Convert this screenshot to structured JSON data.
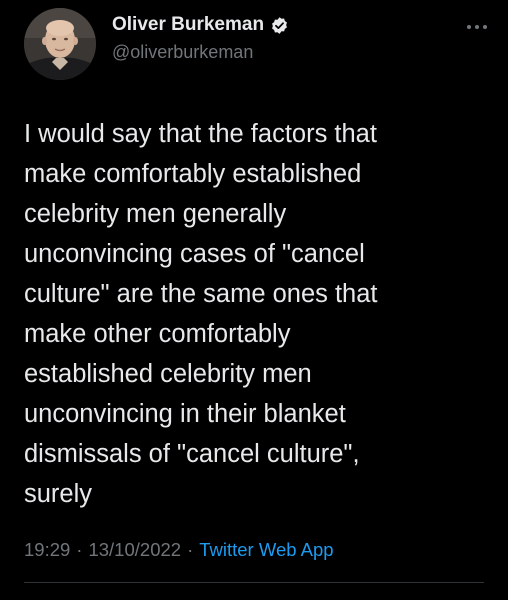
{
  "author": {
    "display_name": "Oliver Burkeman",
    "handle": "@oliverburkeman",
    "verified_icon": "verified-badge-icon",
    "verified_color": "#e7e9ea"
  },
  "tweet": {
    "text": "I would say that the factors that\nmake comfortably established\ncelebrity men generally\nunconvincing cases of \"cancel\nculture\" are the same ones that\nmake other comfortably\nestablished celebrity men\nunconvincing in their blanket\ndismissals of \"cancel culture\",\nsurely",
    "time": "19:29",
    "separator": "·",
    "date": "13/10/2022",
    "source": "Twitter Web App"
  },
  "menu": {
    "more_icon": "more-horizontal-icon"
  },
  "colors": {
    "background": "#000000",
    "text": "#e7e9ea",
    "secondary": "#71767b",
    "link": "#1d9bf0"
  }
}
